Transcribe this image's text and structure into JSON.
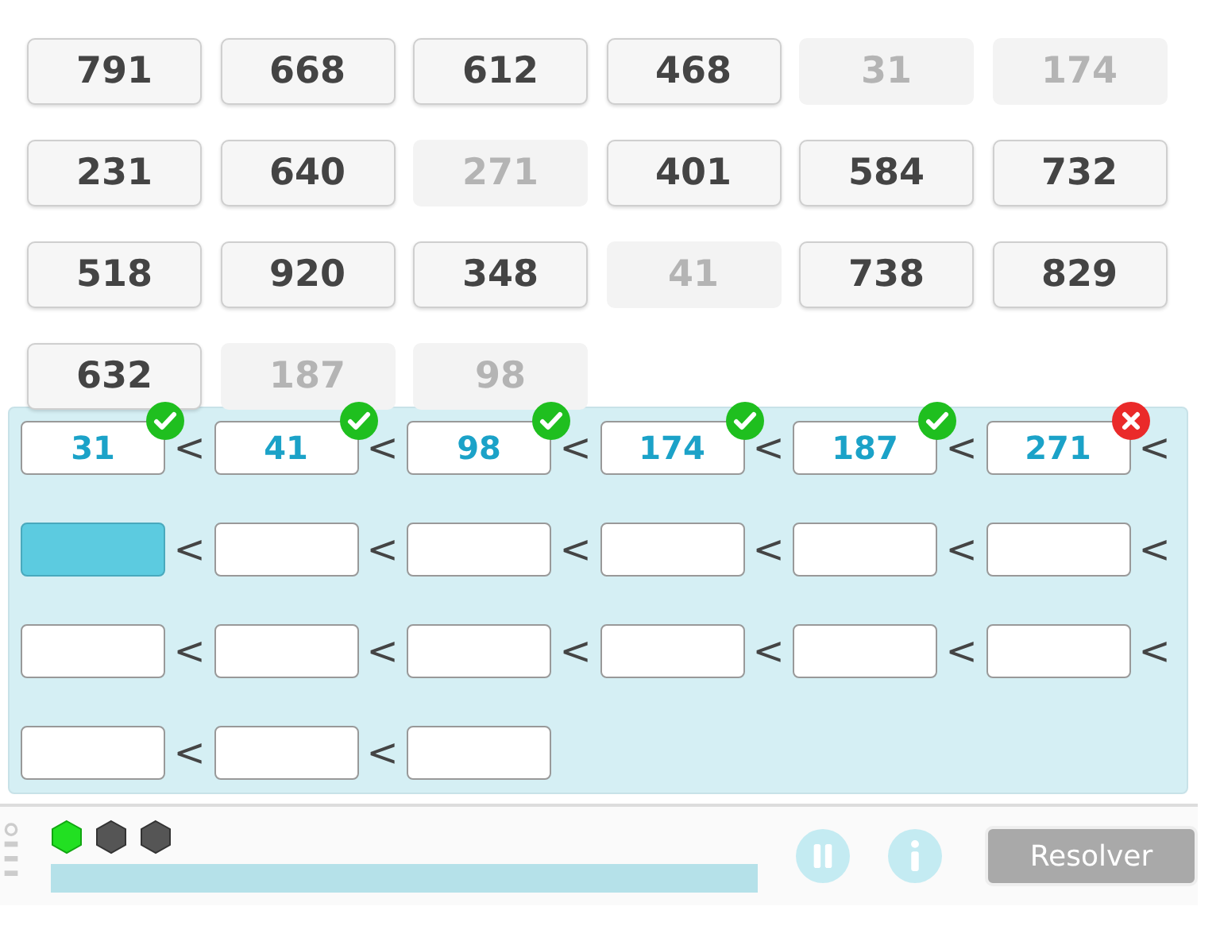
{
  "tiles": [
    {
      "label": "791",
      "used": false
    },
    {
      "label": "668",
      "used": false
    },
    {
      "label": "612",
      "used": false
    },
    {
      "label": "468",
      "used": false
    },
    {
      "label": "31",
      "used": true
    },
    {
      "label": "174",
      "used": true
    },
    {
      "label": "231",
      "used": false
    },
    {
      "label": "640",
      "used": false
    },
    {
      "label": "271",
      "used": true
    },
    {
      "label": "401",
      "used": false
    },
    {
      "label": "584",
      "used": false
    },
    {
      "label": "732",
      "used": false
    },
    {
      "label": "518",
      "used": false
    },
    {
      "label": "920",
      "used": false
    },
    {
      "label": "348",
      "used": false
    },
    {
      "label": "41",
      "used": true
    },
    {
      "label": "738",
      "used": false
    },
    {
      "label": "829",
      "used": false
    },
    {
      "label": "632",
      "used": false
    },
    {
      "label": "187",
      "used": true
    },
    {
      "label": "98",
      "used": true
    }
  ],
  "answer": {
    "separator": "<",
    "slots": [
      {
        "value": "31",
        "correct": true,
        "selected": false
      },
      {
        "value": "41",
        "correct": true,
        "selected": false
      },
      {
        "value": "98",
        "correct": true,
        "selected": false
      },
      {
        "value": "174",
        "correct": true,
        "selected": false
      },
      {
        "value": "187",
        "correct": true,
        "selected": false
      },
      {
        "value": "271",
        "correct": false,
        "selected": false
      },
      {
        "selected": true
      },
      {
        "selected": false
      },
      {
        "selected": false
      },
      {
        "selected": false
      },
      {
        "selected": false
      },
      {
        "selected": false
      },
      {
        "selected": false
      },
      {
        "selected": false
      },
      {
        "selected": false
      },
      {
        "selected": false
      },
      {
        "selected": false
      },
      {
        "selected": false
      },
      {
        "selected": false
      },
      {
        "selected": false
      },
      {
        "selected": false
      }
    ]
  },
  "footer": {
    "lives": [
      {
        "on": true
      },
      {
        "on": false
      },
      {
        "on": false
      }
    ],
    "progress": {
      "level": 1
    },
    "solve_button": {
      "label": "Resolver",
      "disabled": true
    }
  }
}
